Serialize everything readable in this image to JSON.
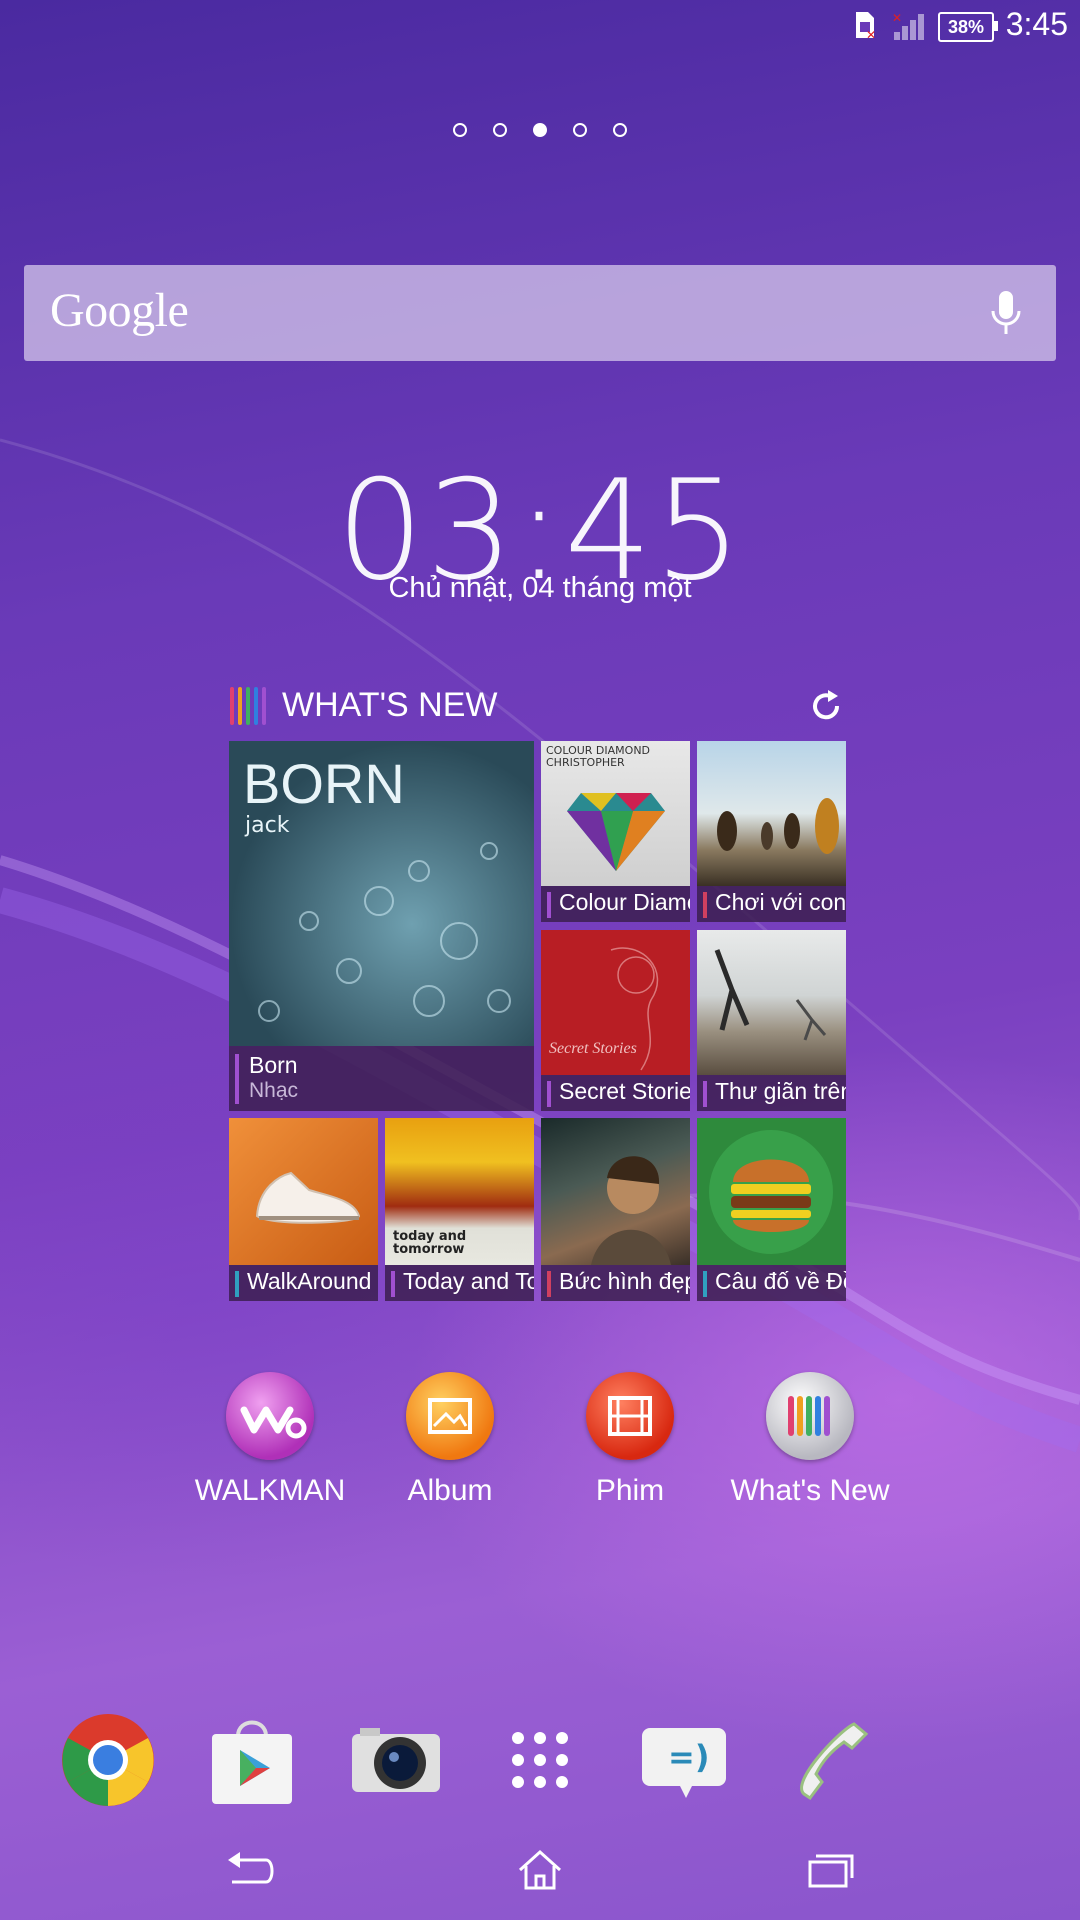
{
  "status_bar": {
    "time": "3:45",
    "battery": "38%"
  },
  "home_pages": {
    "count": 5,
    "active_index": 2
  },
  "search": {
    "logo": "Google",
    "mic_icon": "mic-icon"
  },
  "clock": {
    "time": "03:45",
    "date": "Chủ nhật, 04 tháng một"
  },
  "whats_new": {
    "title": "WHAT'S NEW",
    "tiles": [
      {
        "title": "Born",
        "subtitle": "Nhạc",
        "art_text": "BORN",
        "art_sub": "jack",
        "accent": "#a050d0"
      },
      {
        "title": "Colour Diamond",
        "art_text": "COLOUR DIAMOND CHRISTOPHER",
        "accent": "#a050d0"
      },
      {
        "title": "Chơi với con",
        "accent": "#d04060"
      },
      {
        "title": "Secret Stories",
        "art_text": "Secret Stories",
        "accent": "#a050d0"
      },
      {
        "title": "Thư giãn trên bãi biển",
        "accent": "#a050d0"
      },
      {
        "title": "WalkAround",
        "accent": "#30a0c0"
      },
      {
        "title": "Today and Tomorrow",
        "art_text": "today and tomorrow",
        "accent": "#a050d0"
      },
      {
        "title": "Bức hình đẹp",
        "accent": "#d04060"
      },
      {
        "title": "Câu đố về Đồ ăn",
        "accent": "#30a0c0"
      }
    ]
  },
  "apps": [
    {
      "label": "WALKMAN",
      "icon": "walkman-icon",
      "color": "#c040c0"
    },
    {
      "label": "Album",
      "icon": "album-icon",
      "color": "#f08010"
    },
    {
      "label": "Phim",
      "icon": "film-icon",
      "color": "#e03010"
    },
    {
      "label": "What's New",
      "icon": "whats-new-icon",
      "color": "#c0c0c0"
    }
  ],
  "dock": [
    {
      "icon": "chrome-icon"
    },
    {
      "icon": "play-store-icon"
    },
    {
      "icon": "camera-icon"
    },
    {
      "icon": "app-drawer-icon"
    },
    {
      "icon": "messaging-icon"
    },
    {
      "icon": "phone-icon"
    }
  ],
  "navigation": [
    "back-icon",
    "home-icon",
    "recent-apps-icon"
  ]
}
